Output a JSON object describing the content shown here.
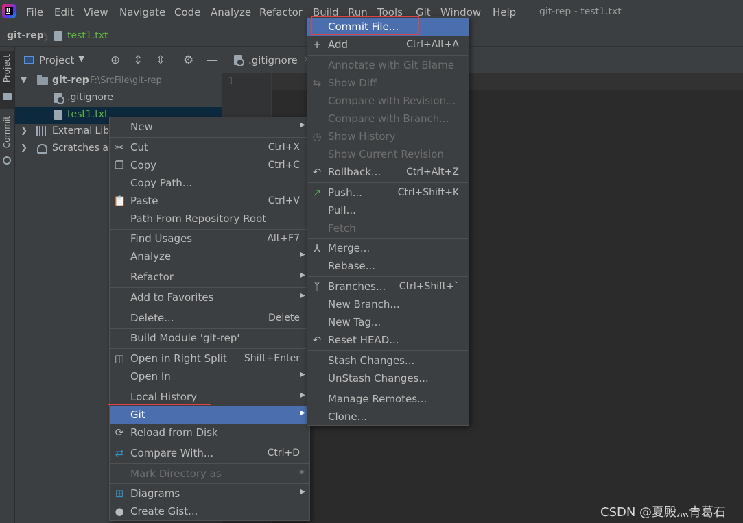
{
  "menubar": {
    "items": [
      "File",
      "Edit",
      "View",
      "Navigate",
      "Code",
      "Analyze",
      "Refactor",
      "Build",
      "Run",
      "Tools",
      "Git",
      "Window",
      "Help"
    ],
    "window_title": "git-rep - test1.txt"
  },
  "breadcrumb": {
    "root": "git-rep",
    "separator": "〉",
    "file": "test1.txt"
  },
  "stripe": {
    "project": "Project",
    "commit": "Commit"
  },
  "project_panel": {
    "title": "Project",
    "tree": {
      "root_name": "git-rep",
      "root_path": "F:\\SrcFile\\git-rep",
      "gitignore": ".gitignore",
      "test_file": "test1.txt",
      "external": "External Libr",
      "scratches": "Scratches an"
    }
  },
  "editor": {
    "tab_label": ".gitignore",
    "tab_close": "×",
    "line_number": "1"
  },
  "main_menu": {
    "items": [
      {
        "label": "New",
        "sub": "▶"
      },
      {
        "label": "Cut",
        "shortcut": "Ctrl+X"
      },
      {
        "label": "Copy",
        "shortcut": "Ctrl+C"
      },
      {
        "label": "Copy Path..."
      },
      {
        "label": "Paste",
        "shortcut": "Ctrl+V"
      },
      {
        "label": "Path From Repository Root"
      },
      {
        "label": "Find Usages",
        "shortcut": "Alt+F7"
      },
      {
        "label": "Analyze",
        "sub": "▶"
      },
      {
        "label": "Refactor",
        "sub": "▶"
      },
      {
        "label": "Add to Favorites",
        "sub": "▶"
      },
      {
        "label": "Delete...",
        "shortcut": "Delete"
      },
      {
        "label": "Build Module 'git-rep'"
      },
      {
        "label": "Open in Right Split",
        "shortcut": "Shift+Enter"
      },
      {
        "label": "Open In",
        "sub": "▶"
      },
      {
        "label": "Local History",
        "sub": "▶"
      },
      {
        "label": "Git",
        "sub": "▶"
      },
      {
        "label": "Reload from Disk"
      },
      {
        "label": "Compare With...",
        "shortcut": "Ctrl+D"
      },
      {
        "label": "Mark Directory as",
        "sub": "▶"
      },
      {
        "label": "Diagrams",
        "sub": "▶"
      },
      {
        "label": "Create Gist..."
      }
    ]
  },
  "git_menu": {
    "items": [
      {
        "label": "Commit File..."
      },
      {
        "label": "Add",
        "shortcut": "Ctrl+Alt+A"
      },
      {
        "label": "Annotate with Git Blame"
      },
      {
        "label": "Show Diff"
      },
      {
        "label": "Compare with Revision..."
      },
      {
        "label": "Compare with Branch..."
      },
      {
        "label": "Show History"
      },
      {
        "label": "Show Current Revision"
      },
      {
        "label": "Rollback...",
        "shortcut": "Ctrl+Alt+Z"
      },
      {
        "label": "Push...",
        "shortcut": "Ctrl+Shift+K"
      },
      {
        "label": "Pull..."
      },
      {
        "label": "Fetch"
      },
      {
        "label": "Merge..."
      },
      {
        "label": "Rebase..."
      },
      {
        "label": "Branches...",
        "shortcut": "Ctrl+Shift+`"
      },
      {
        "label": "New Branch..."
      },
      {
        "label": "New Tag..."
      },
      {
        "label": "Reset HEAD..."
      },
      {
        "label": "Stash Changes..."
      },
      {
        "label": "UnStash Changes..."
      },
      {
        "label": "Manage Remotes..."
      },
      {
        "label": "Clone..."
      }
    ]
  },
  "colors": {
    "highlight": "#4b6eaf",
    "red_box": "#e04343",
    "vcs_green": "#62b543"
  },
  "watermark": "CSDN @夏殿灬青葛石"
}
